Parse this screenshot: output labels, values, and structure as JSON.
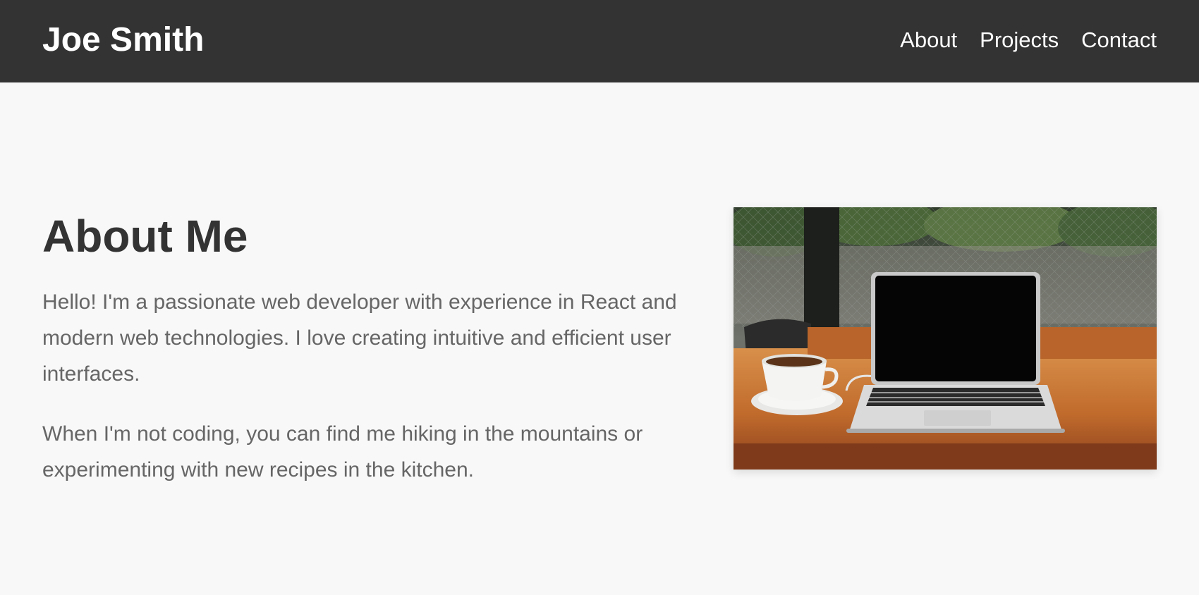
{
  "header": {
    "brand": "Joe Smith",
    "nav": [
      "About",
      "Projects",
      "Contact"
    ]
  },
  "about": {
    "heading": "About Me",
    "paragraphs": [
      "Hello! I'm a passionate web developer with experience in React and modern web technologies. I love creating intuitive and efficient user interfaces.",
      "When I'm not coding, you can find me hiking in the mountains or experimenting with new recipes in the kitchen."
    ],
    "image_subject": "laptop-and-coffee-cup-photo"
  },
  "colors": {
    "header_bg": "#333333",
    "page_bg": "#f8f8f8",
    "heading": "#333333",
    "body_text": "#666666"
  }
}
